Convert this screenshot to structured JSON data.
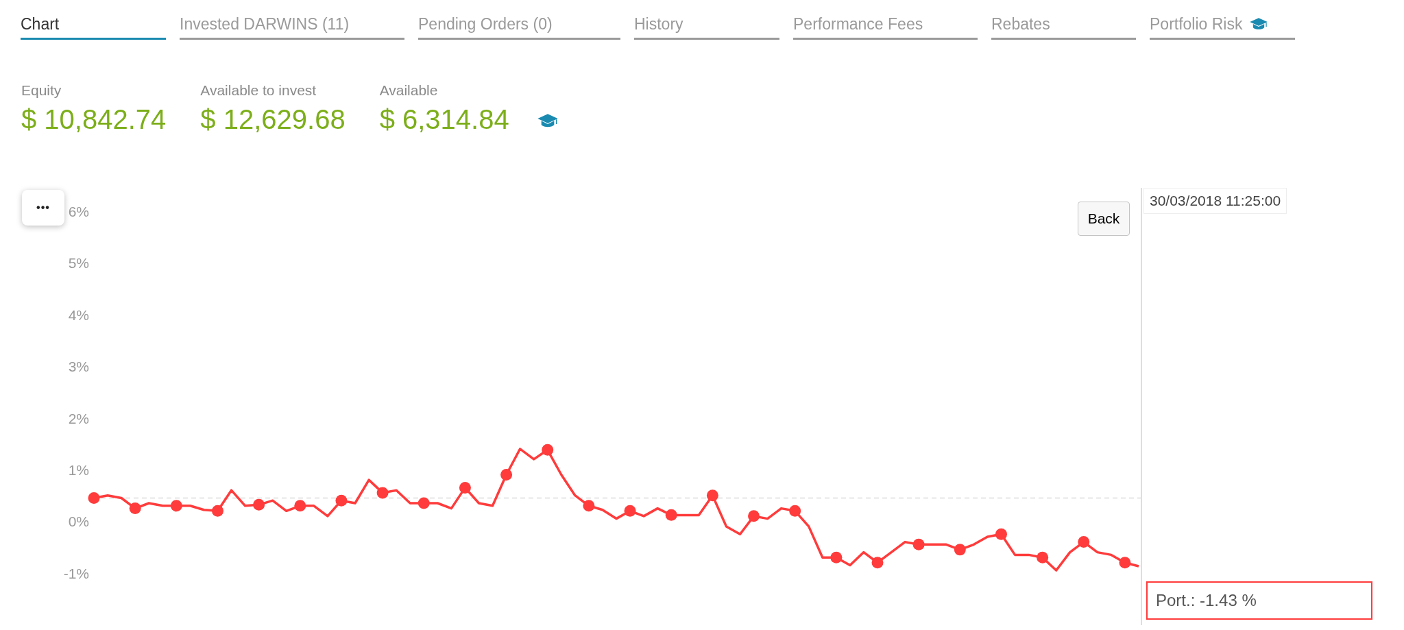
{
  "tabs": [
    {
      "label": "Chart",
      "selected": true,
      "icon": false
    },
    {
      "label": "Invested DARWINS (11)",
      "selected": false,
      "icon": false
    },
    {
      "label": "Pending Orders (0)",
      "selected": false,
      "icon": false
    },
    {
      "label": "History",
      "selected": false,
      "icon": false
    },
    {
      "label": "Performance Fees",
      "selected": false,
      "icon": false
    },
    {
      "label": "Rebates",
      "selected": false,
      "icon": false
    },
    {
      "label": "Portfolio Risk",
      "selected": false,
      "icon": true
    }
  ],
  "stats": [
    {
      "label": "Equity",
      "value": "$ 10,842.74"
    },
    {
      "label": "Available to invest",
      "value": "$ 12,629.68"
    },
    {
      "label": "Available",
      "value": "$ 6,314.84"
    }
  ],
  "chart": {
    "menu_button": "•••",
    "back_button": "Back",
    "crosshair_date": "30/03/2018 11:25:00",
    "tooltip": "Port.: -1.43 %",
    "chart_data": {
      "type": "line",
      "ylim": [
        -1,
        6
      ],
      "ref_lines": [
        {
          "axis": "y",
          "value": 0.45
        }
      ],
      "yticks": [
        {
          "value": -1,
          "label": "-1%"
        },
        {
          "value": 0,
          "label": "0%"
        },
        {
          "value": 1,
          "label": "1%"
        },
        {
          "value": 2,
          "label": "2%"
        },
        {
          "value": 3,
          "label": "3%"
        },
        {
          "value": 4,
          "label": "4%"
        },
        {
          "value": 5,
          "label": "5%"
        },
        {
          "value": 6,
          "label": "6%"
        }
      ],
      "series": [
        {
          "color": "#ff3b3b",
          "values": [
            0.45,
            0.5,
            0.45,
            0.25,
            0.35,
            0.3,
            0.3,
            0.3,
            0.22,
            0.2,
            0.6,
            0.3,
            0.32,
            0.4,
            0.2,
            0.3,
            0.3,
            0.1,
            0.4,
            0.35,
            0.8,
            0.55,
            0.6,
            0.35,
            0.35,
            0.35,
            0.25,
            0.65,
            0.35,
            0.3,
            0.9,
            1.4,
            1.2,
            1.38,
            0.9,
            0.5,
            0.3,
            0.22,
            0.05,
            0.2,
            0.1,
            0.25,
            0.12,
            0.12,
            0.12,
            0.5,
            -0.1,
            -0.25,
            0.1,
            0.05,
            0.25,
            0.2,
            -0.1,
            -0.7,
            -0.7,
            -0.85,
            -0.6,
            -0.8,
            -0.6,
            -0.4,
            -0.45,
            -0.45,
            -0.45,
            -0.55,
            -0.45,
            -0.3,
            -0.25,
            -0.65,
            -0.65,
            -0.7,
            -0.95,
            -0.6,
            -0.4,
            -0.6,
            -0.65,
            -0.8,
            -0.87
          ]
        }
      ]
    }
  }
}
